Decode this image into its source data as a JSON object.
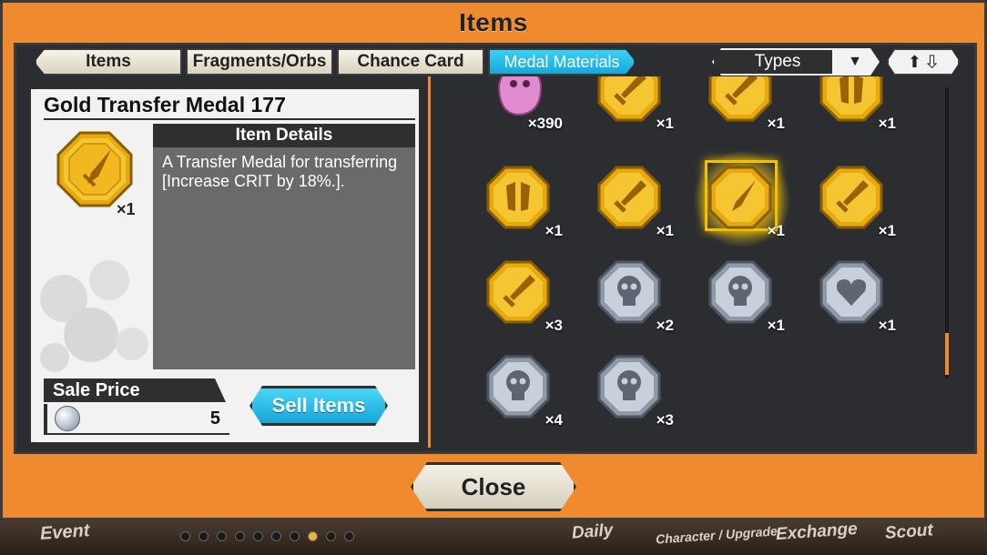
{
  "dialog": {
    "title": "Items",
    "close_label": "Close"
  },
  "tabs": [
    {
      "label": "Items",
      "active": false
    },
    {
      "label": "Fragments/Orbs",
      "active": false
    },
    {
      "label": "Chance Card",
      "active": false
    },
    {
      "label": "Medal Materials",
      "active": true
    }
  ],
  "filter": {
    "types_label": "Types",
    "types_icon": "chevron-down-icon",
    "sort_icon": "sort-up-down-icon"
  },
  "detail": {
    "name": "Gold Transfer Medal 177",
    "quantity": "×1",
    "header": "Item Details",
    "description": "A Transfer Medal for transferring [Increase CRIT by 18%.].",
    "sale_label": "Sale Price",
    "sale_price": "5",
    "sell_label": "Sell Items"
  },
  "grid": {
    "items": [
      {
        "kind": "pink",
        "qty": "×390"
      },
      {
        "kind": "gold-sword",
        "qty": "×1"
      },
      {
        "kind": "gold-sword",
        "qty": "×1"
      },
      {
        "kind": "gold-armor",
        "qty": "×1"
      },
      {
        "kind": "gold-armor",
        "qty": "×1"
      },
      {
        "kind": "gold-sword",
        "qty": "×1"
      },
      {
        "kind": "gold-needle",
        "qty": "×1",
        "selected": true
      },
      {
        "kind": "gold-sword",
        "qty": "×1"
      },
      {
        "kind": "gold-sword",
        "qty": "×3"
      },
      {
        "kind": "silver-skull",
        "qty": "×2"
      },
      {
        "kind": "silver-skull",
        "qty": "×1"
      },
      {
        "kind": "silver-heart",
        "qty": "×1"
      },
      {
        "kind": "silver-skull",
        "qty": "×4"
      },
      {
        "kind": "silver-skull",
        "qty": "×3"
      }
    ]
  },
  "bottom_nav": {
    "labels": [
      "Event",
      "Daily",
      "Character / Upgrade",
      "Exchange",
      "Scout"
    ],
    "page_count": 10,
    "active_page": 7
  },
  "colors": {
    "orange": "#f08a2f",
    "accent_blue": "#16a6da",
    "gold": "#f2b51b",
    "silver": "#a9b3c2"
  }
}
